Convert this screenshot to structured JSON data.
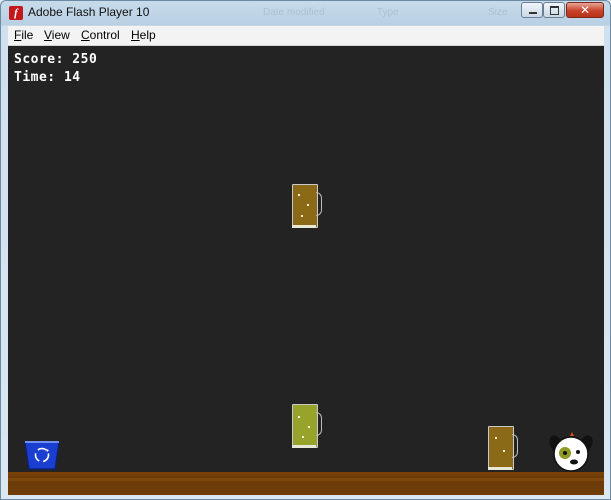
{
  "window": {
    "title": "Adobe Flash Player 10",
    "ghost_headers": [
      "Date modified",
      "Type",
      "Size"
    ],
    "close_glyph": "✕"
  },
  "menu": {
    "items": [
      {
        "label": "File",
        "accel": "F"
      },
      {
        "label": "View",
        "accel": "V"
      },
      {
        "label": "Control",
        "accel": "C"
      },
      {
        "label": "Help",
        "accel": "H"
      }
    ]
  },
  "game": {
    "score_label": "Score: 250",
    "time_label": "Time: 14",
    "colors": {
      "stage_bg": "#232323",
      "ground": "#6b3a08",
      "mug_dark": "#8a6a16",
      "mug_light": "#97a32a",
      "bin_blue": "#1a3fd0"
    },
    "icons": [
      "recycle-bin-icon",
      "dog-character-icon",
      "beer-mug-icon"
    ]
  }
}
